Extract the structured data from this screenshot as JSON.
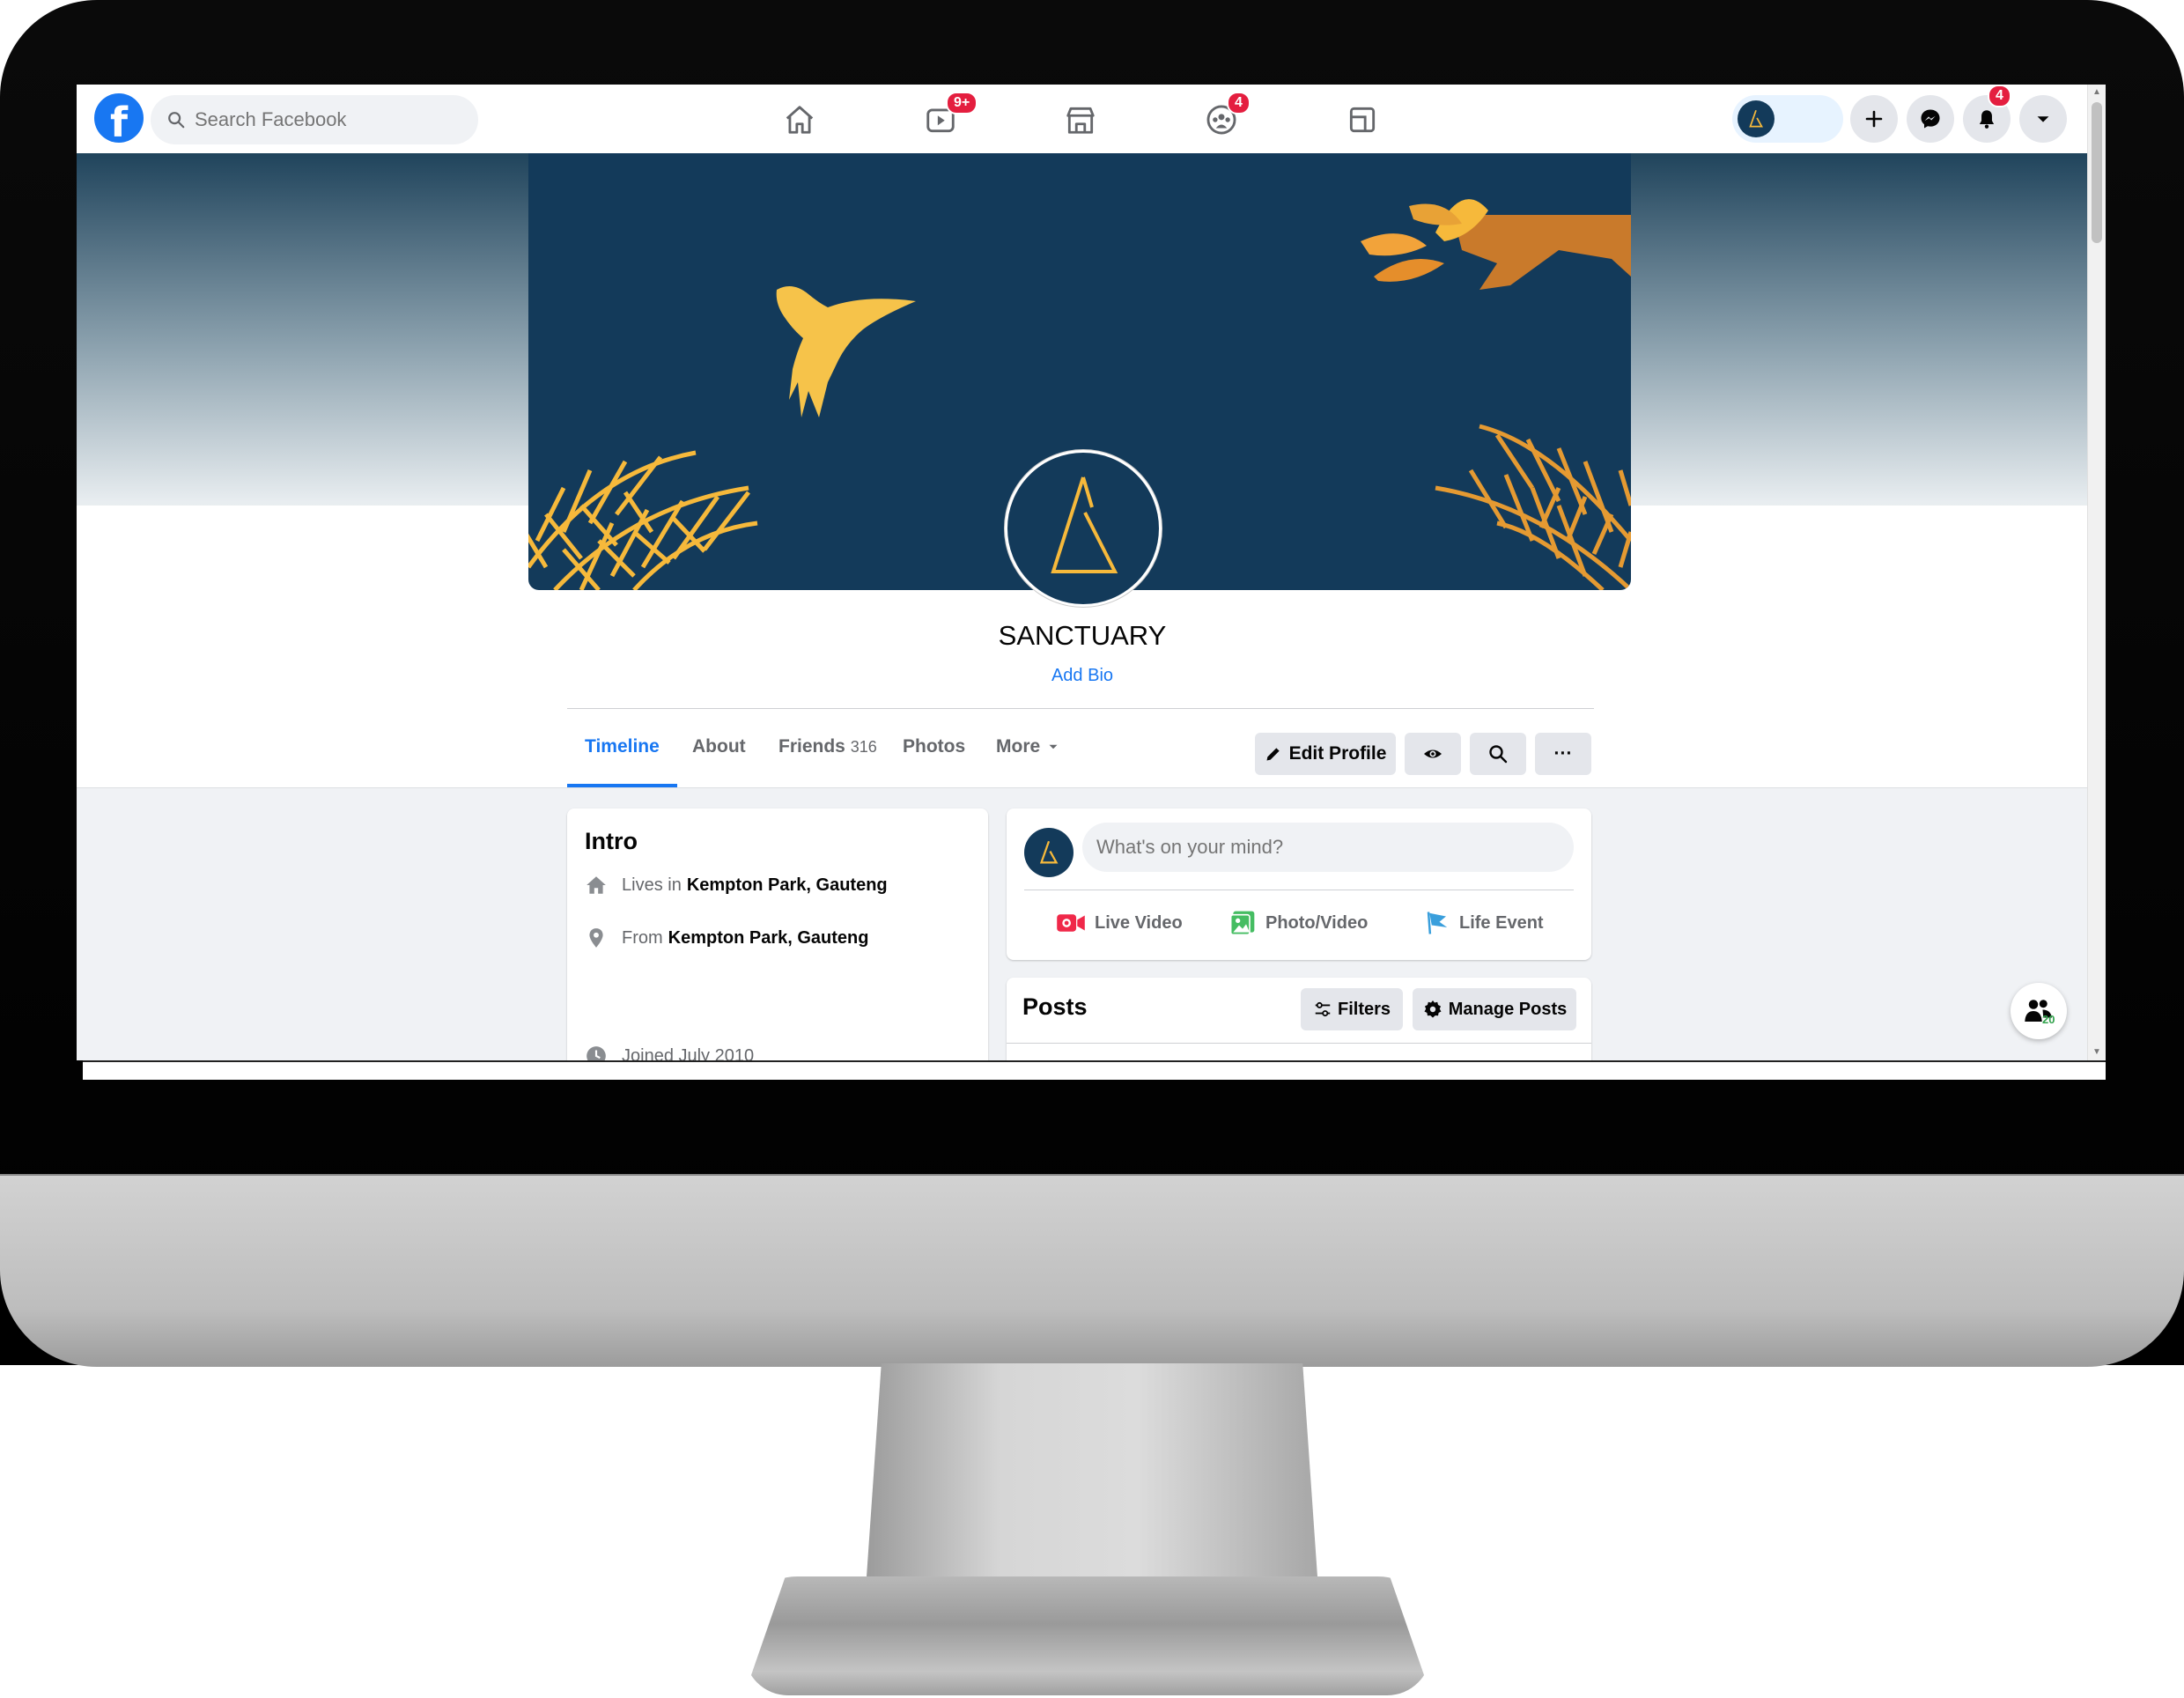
{
  "topnav": {
    "search_placeholder": "Search Facebook",
    "watch_badge": "9+",
    "groups_badge": "4",
    "notifications_badge": "4"
  },
  "profile": {
    "name": "SANCTUARY",
    "add_bio": "Add Bio"
  },
  "tabs": [
    {
      "label": "Timeline"
    },
    {
      "label": "About"
    },
    {
      "label": "Friends",
      "count": "316"
    },
    {
      "label": "Photos"
    },
    {
      "label": "More"
    }
  ],
  "actions": {
    "edit_profile": "Edit Profile",
    "more_dots": "···"
  },
  "intro": {
    "title": "Intro",
    "lives_prefix": "Lives in",
    "lives_value": "Kempton Park, Gauteng",
    "from_prefix": "From",
    "from_value": "Kempton Park, Gauteng",
    "joined": "Joined July 2010"
  },
  "composer": {
    "placeholder": "What's on your mind?",
    "live_video": "Live Video",
    "photo_video": "Photo/Video",
    "life_event": "Life Event"
  },
  "posts": {
    "title": "Posts",
    "filters": "Filters",
    "manage": "Manage Posts"
  },
  "contacts_fab": {
    "count": "20"
  },
  "colors": {
    "brand": "#1877f2",
    "cover_bg": "#133a5a",
    "gold": "#f6b93b",
    "badge": "#e41e3f"
  }
}
